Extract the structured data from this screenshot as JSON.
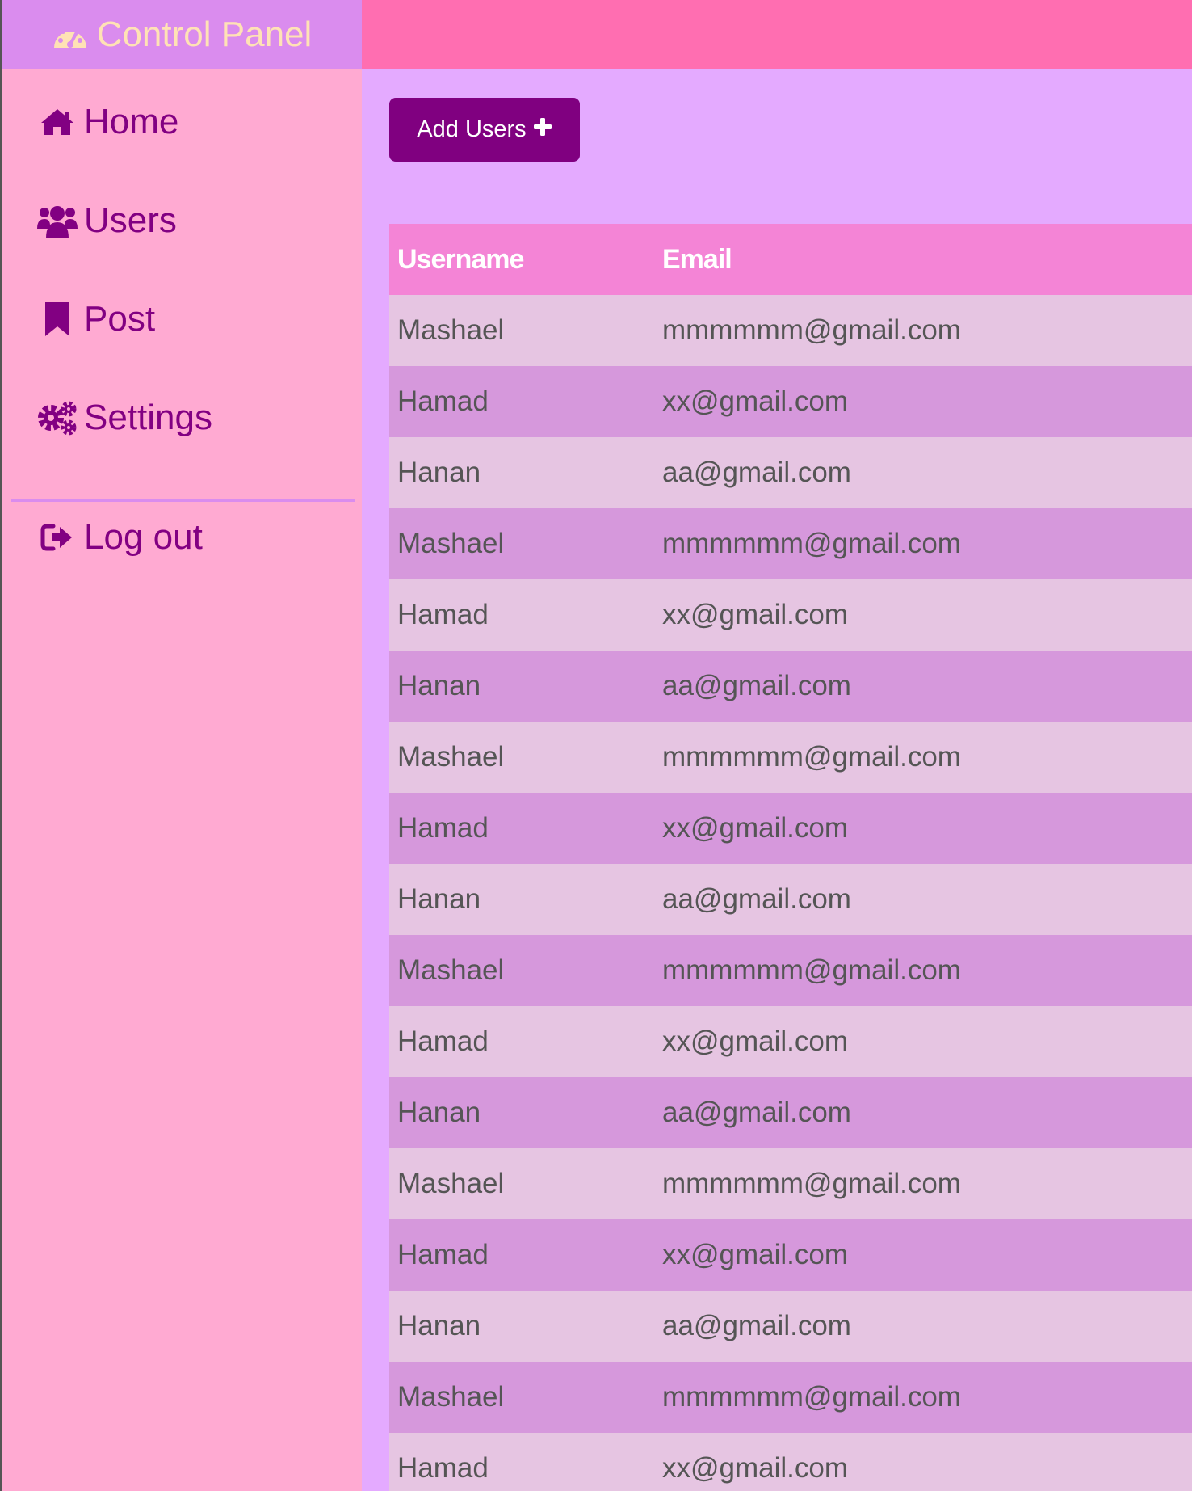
{
  "brand": {
    "title": "Control Panel",
    "icon": "dashboard-gauge-icon",
    "text_color": "#ffe2b5",
    "background": "#da8cee"
  },
  "topbar": {
    "background": "#ff6eb1"
  },
  "sidebar": {
    "items": [
      {
        "label": "Home",
        "icon": "home-icon"
      },
      {
        "label": "Users",
        "icon": "users-icon"
      },
      {
        "label": "Post",
        "icon": "bookmark-icon"
      },
      {
        "label": "Settings",
        "icon": "gears-icon"
      }
    ],
    "logout": {
      "label": "Log out",
      "icon": "sign-out-icon"
    },
    "background": "#ffaad2",
    "text_color": "#820082"
  },
  "main": {
    "background": "#e4aaff",
    "add_button": {
      "label": "Add Users",
      "icon": "plus-icon",
      "background": "#800080"
    },
    "table": {
      "headers": {
        "username": "Username",
        "email": "Email"
      },
      "header_background": "#f484d6",
      "row_colors": [
        "#e6c5e2",
        "#d698dc"
      ],
      "rows": [
        {
          "username": "Mashael",
          "email": "mmmmmm@gmail.com"
        },
        {
          "username": "Hamad",
          "email": "xx@gmail.com"
        },
        {
          "username": "Hanan",
          "email": "aa@gmail.com"
        },
        {
          "username": "Mashael",
          "email": "mmmmmm@gmail.com"
        },
        {
          "username": "Hamad",
          "email": "xx@gmail.com"
        },
        {
          "username": "Hanan",
          "email": "aa@gmail.com"
        },
        {
          "username": "Mashael",
          "email": "mmmmmm@gmail.com"
        },
        {
          "username": "Hamad",
          "email": "xx@gmail.com"
        },
        {
          "username": "Hanan",
          "email": "aa@gmail.com"
        },
        {
          "username": "Mashael",
          "email": "mmmmmm@gmail.com"
        },
        {
          "username": "Hamad",
          "email": "xx@gmail.com"
        },
        {
          "username": "Hanan",
          "email": "aa@gmail.com"
        },
        {
          "username": "Mashael",
          "email": "mmmmmm@gmail.com"
        },
        {
          "username": "Hamad",
          "email": "xx@gmail.com"
        },
        {
          "username": "Hanan",
          "email": "aa@gmail.com"
        },
        {
          "username": "Mashael",
          "email": "mmmmmm@gmail.com"
        },
        {
          "username": "Hamad",
          "email": "xx@gmail.com"
        }
      ]
    }
  }
}
